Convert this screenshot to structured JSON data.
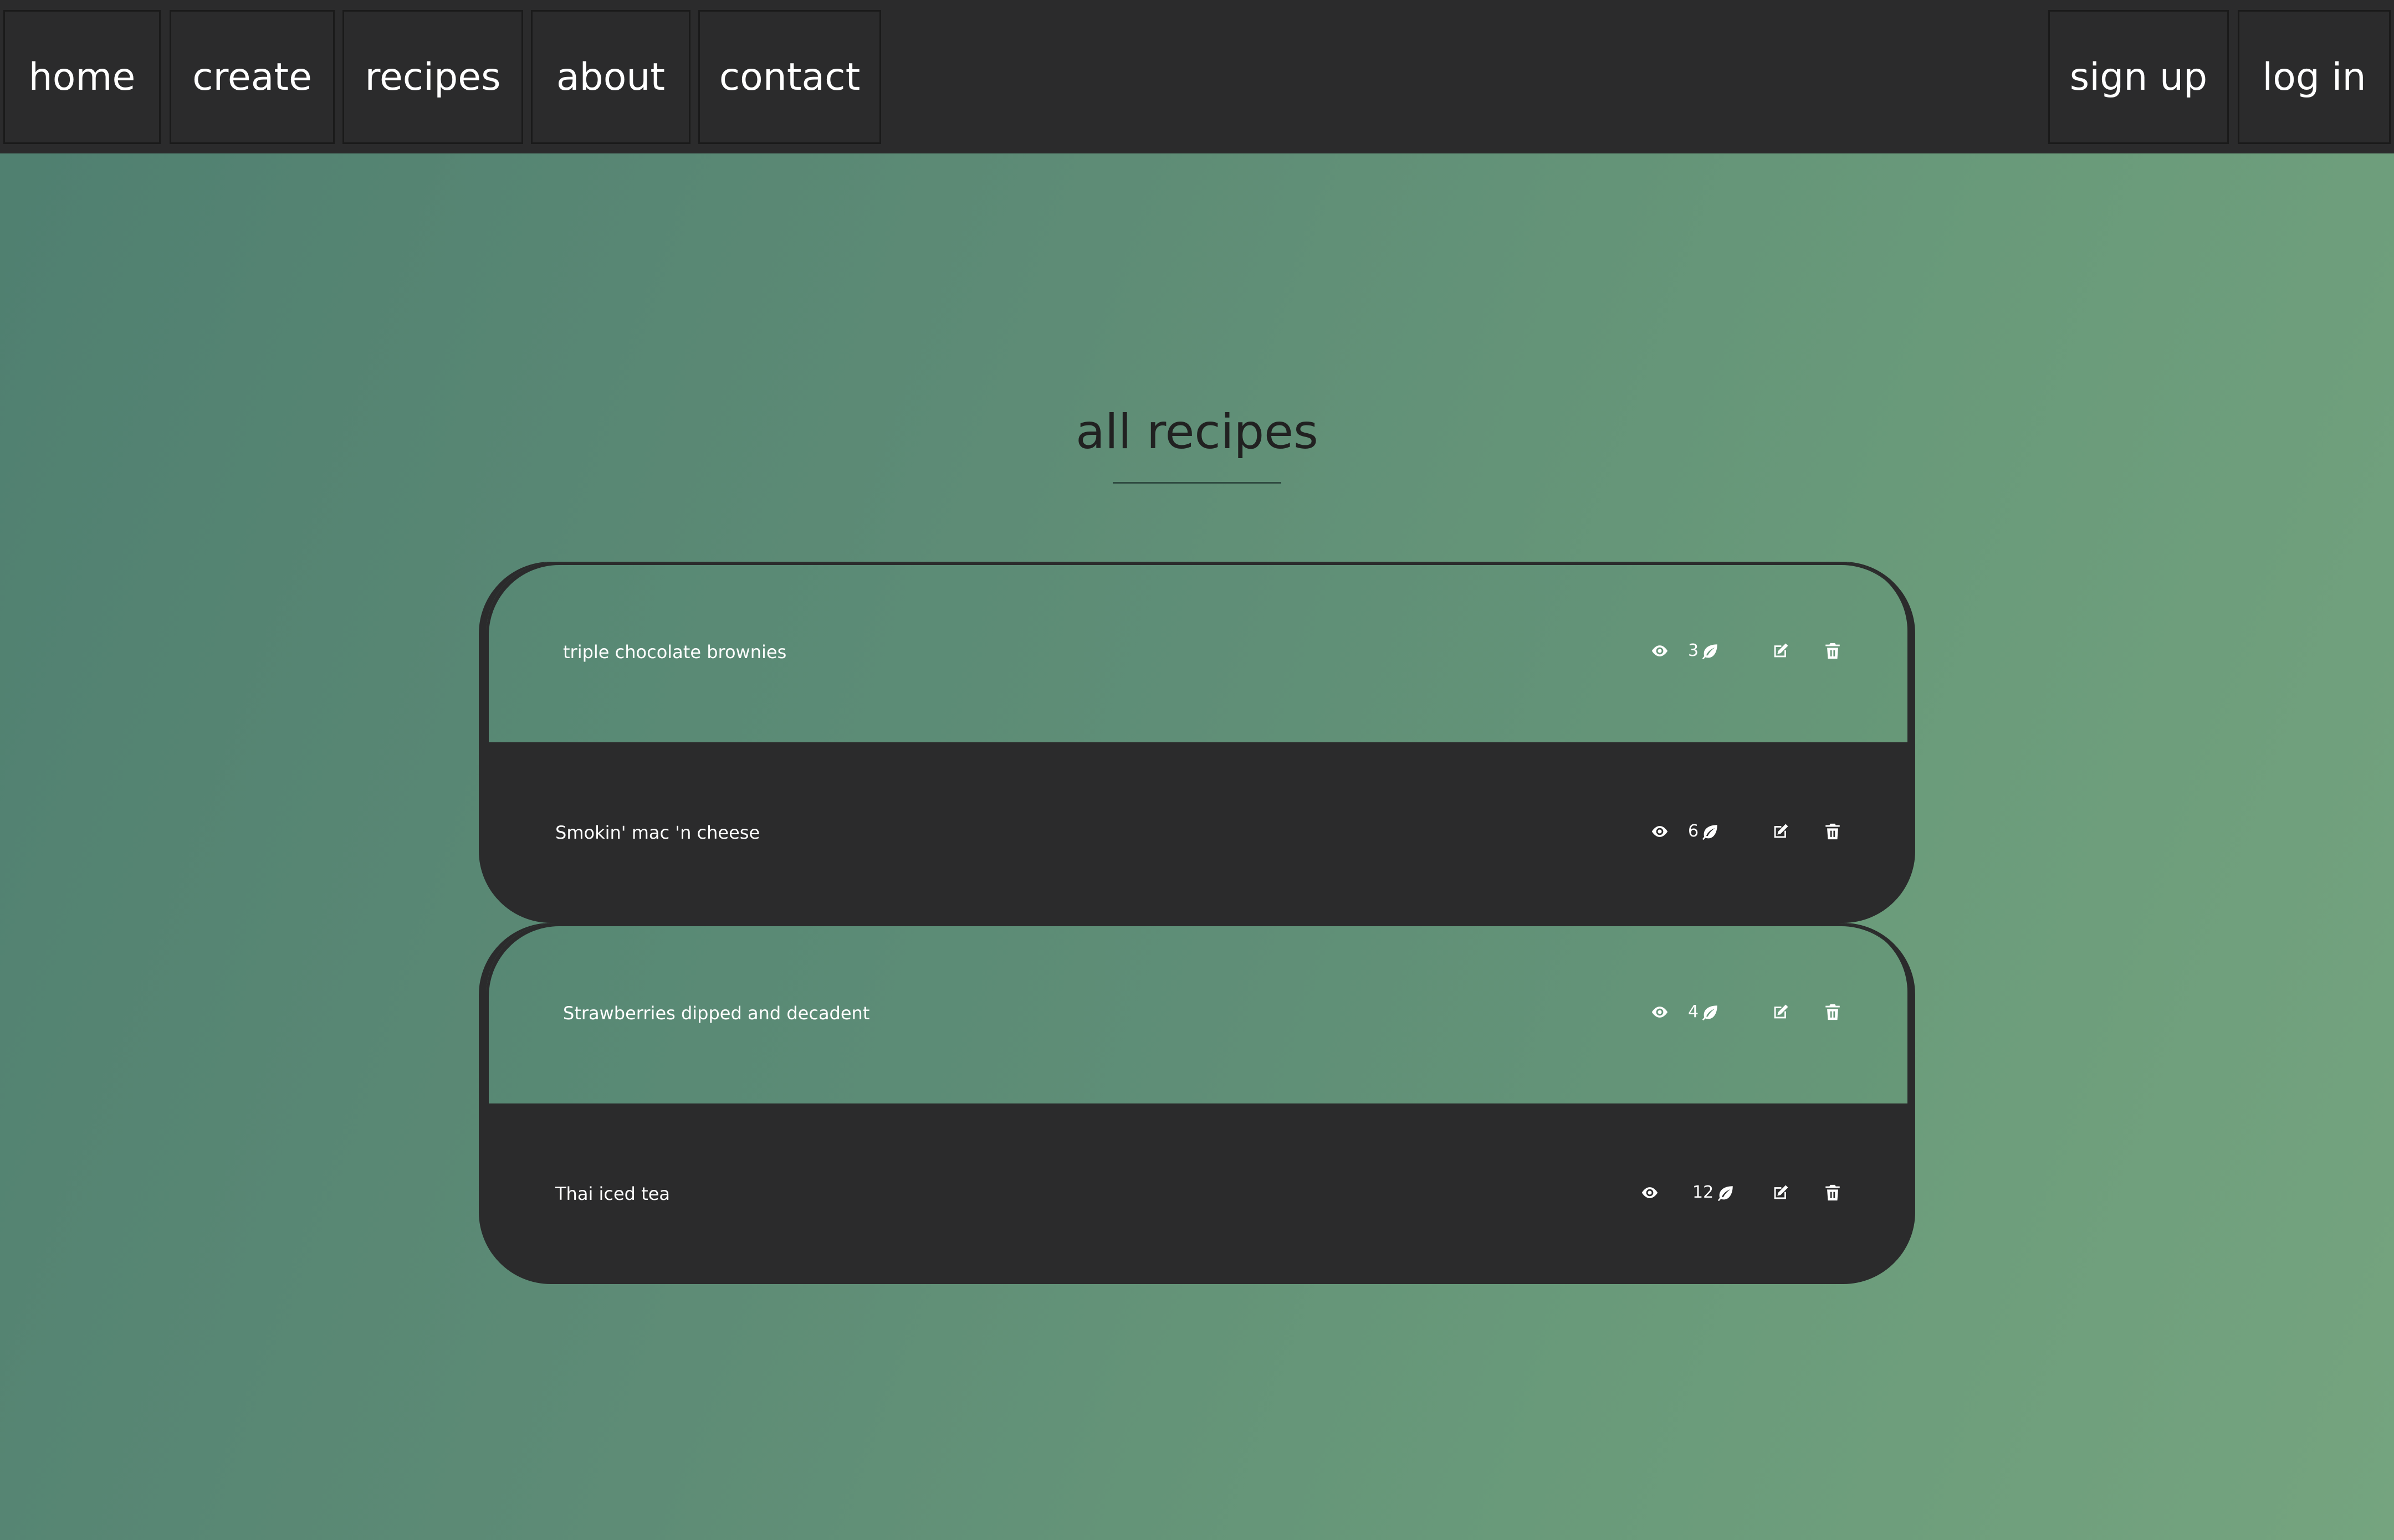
{
  "nav": {
    "left": [
      {
        "label": "home"
      },
      {
        "label": "create"
      },
      {
        "label": "recipes"
      },
      {
        "label": "about"
      },
      {
        "label": "contact"
      }
    ],
    "right": [
      {
        "label": "sign up"
      },
      {
        "label": "log in"
      }
    ]
  },
  "page": {
    "title": "all recipes"
  },
  "recipes": [
    {
      "name": "triple chocolate brownies",
      "count": "3"
    },
    {
      "name": "Smokin' mac 'n cheese",
      "count": "6"
    },
    {
      "name": "Strawberries dipped and decadent",
      "count": "4"
    },
    {
      "name": "Thai iced tea",
      "count": "12"
    }
  ],
  "icons": {
    "view": "eye-icon",
    "count": "leaf-icon",
    "edit": "edit-icon",
    "delete": "trash-icon"
  },
  "colors": {
    "nav_background": "#2b2b2c",
    "card_dark": "#2b2b2c",
    "background_start": "#4f7f70",
    "background_end": "#75a47f",
    "text_light": "#ffffff",
    "title_text": "#212121"
  }
}
